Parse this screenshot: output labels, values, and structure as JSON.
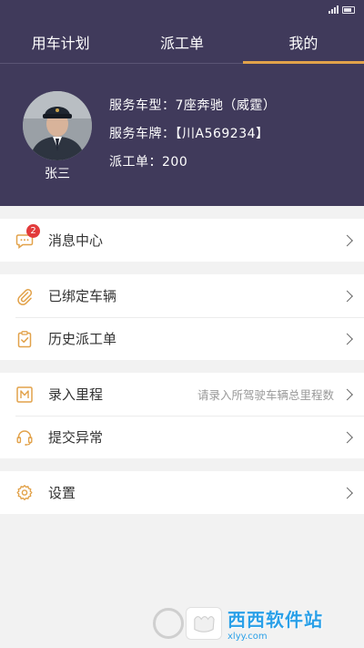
{
  "tabs": [
    {
      "label": "用车计划",
      "active": false
    },
    {
      "label": "派工单",
      "active": false
    },
    {
      "label": "我的",
      "active": true
    }
  ],
  "profile": {
    "name": "张三",
    "vehicle_type": "服务车型：7座奔驰（威霆）",
    "plate": "服务车牌：【川A569234】",
    "dispatch": "派工单：200"
  },
  "menu": {
    "messages": {
      "label": "消息中心",
      "icon": "chat-bubble-icon",
      "badge": "2"
    },
    "bound_vehicle": {
      "label": "已绑定车辆",
      "icon": "paperclip-icon"
    },
    "history": {
      "label": "历史派工单",
      "icon": "clipboard-check-icon"
    },
    "mileage": {
      "label": "录入里程",
      "icon": "m-box-icon",
      "hint": "请录入所驾驶车辆总里程数"
    },
    "report": {
      "label": "提交异常",
      "icon": "headset-icon"
    },
    "settings": {
      "label": "设置",
      "icon": "gear-icon"
    }
  },
  "watermark": {
    "title": "西西软件站",
    "url": "xlyy.com"
  },
  "colors": {
    "header": "#403a5b",
    "accent": "#e2a24a",
    "badge": "#e23b3b"
  }
}
